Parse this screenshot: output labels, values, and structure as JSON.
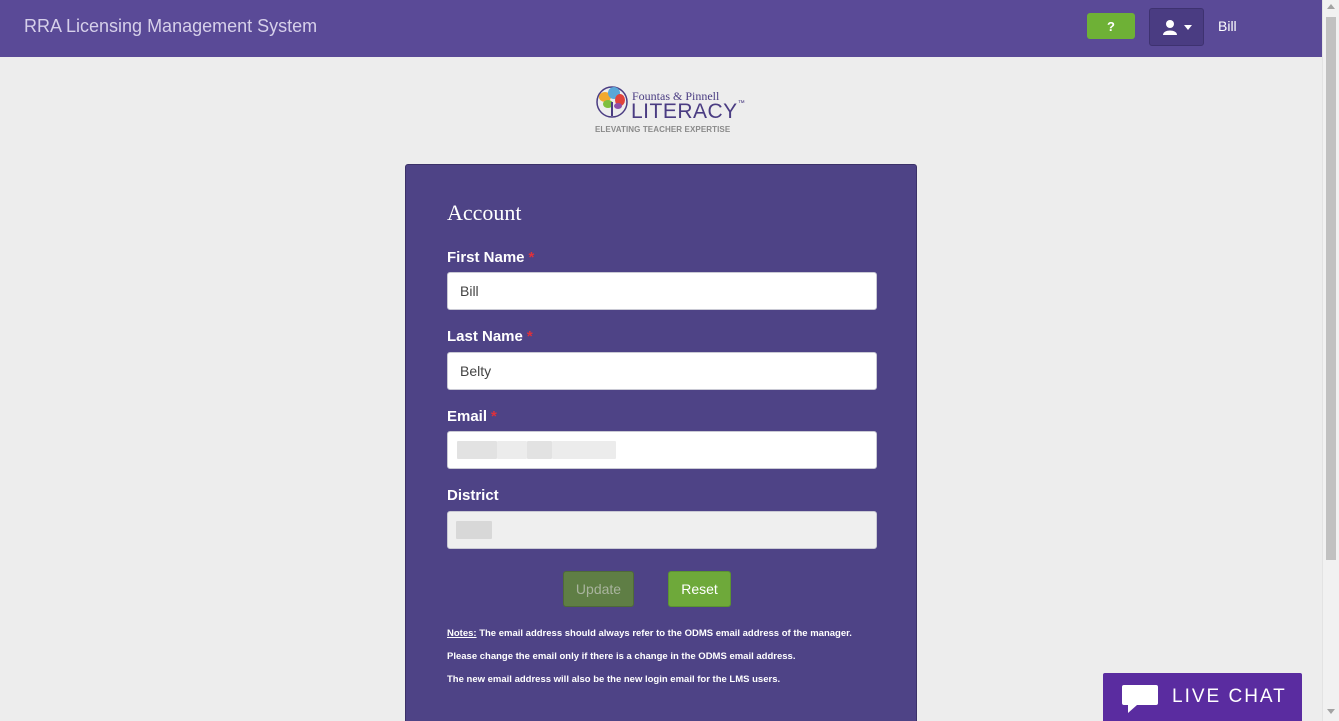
{
  "navbar": {
    "title": "RRA Licensing Management System",
    "help_label": "?",
    "user_name": "Bill"
  },
  "logo": {
    "top": "Fountas & Pinnell",
    "main": "LITERACY",
    "tm": "™",
    "tagline": "ELEVATING TEACHER EXPERTISE"
  },
  "form": {
    "title": "Account",
    "first_name_label": "First Name",
    "first_name_value": "Bill",
    "last_name_label": "Last Name",
    "last_name_value": "Belty",
    "email_label": "Email",
    "district_label": "District",
    "required_mark": "*",
    "update_label": "Update",
    "reset_label": "Reset"
  },
  "notes": {
    "heading": "Notes:",
    "line1": "The email address should always refer to the ODMS email address of the manager.",
    "line2": "Please change the email only if there is a change in the ODMS email address.",
    "line3": "The new email address will also be the new login email for the LMS users."
  },
  "live_chat": {
    "label": "LIVE CHAT"
  },
  "colors": {
    "navbar": "#5a4a97",
    "card": "#4e4386",
    "help_button": "#6eb136",
    "reset_button": "#6ea93a",
    "live_chat": "#5a2ca0"
  }
}
